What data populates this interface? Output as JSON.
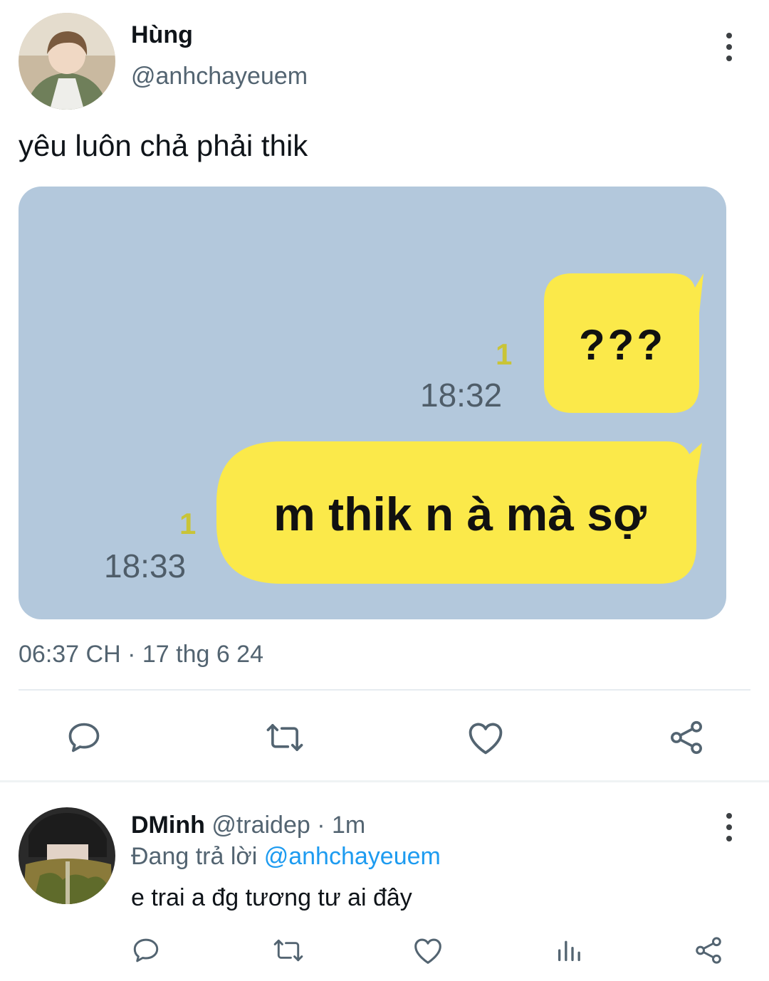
{
  "tweet": {
    "author_name": "Hùng",
    "author_handle": "@anhchayeuem",
    "text": "yêu luôn chả phải thik",
    "timestamp": "06:37 CH · 17 thg 6 24",
    "media": {
      "messages": [
        {
          "text": "???",
          "read_count": "1",
          "time": "18:32"
        },
        {
          "text": "m thik n à mà sợ",
          "read_count": "1",
          "time": "18:33"
        }
      ]
    },
    "actions": [
      "reply-icon",
      "retweet-icon",
      "like-icon",
      "share-icon"
    ]
  },
  "reply": {
    "author_name": "DMinh",
    "author_handle": "@traidep",
    "time_ago": "· 1m",
    "replying_prefix": "Đang trả lời",
    "replying_to": "@anhchayeuem",
    "text": "e trai a đg tương tư ai đây",
    "actions": [
      "reply-icon",
      "retweet-icon",
      "like-icon",
      "stats-icon",
      "share-icon"
    ]
  },
  "colors": {
    "media_background": "#b3c8dc",
    "bubble": "#fbe94a",
    "mention": "#1d9bf0",
    "secondary_text": "#536471"
  }
}
